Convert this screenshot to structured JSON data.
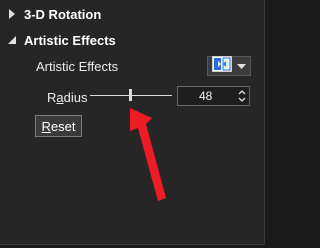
{
  "sections": {
    "rotation": {
      "title": "3-D Rotation",
      "expanded": false
    },
    "artistic": {
      "title": "Artistic Effects",
      "expanded": true
    }
  },
  "artistic_effects": {
    "label": "Artistic Effects",
    "radius": {
      "label_pre": "R",
      "label_underlined": "a",
      "label_post": "dius",
      "value": "48",
      "slider_fraction": 0.48
    },
    "reset": {
      "label_underlined": "R",
      "label_rest": "eset"
    }
  },
  "colors": {
    "pane_bg": "#262626",
    "accent_red": "#ee1c24",
    "effect_icon_blue": "#2a6fd6"
  },
  "icons": {
    "collapsed": "triangle-right-icon",
    "expanded": "triangle-down-icon",
    "effects": "artistic-effects-icon",
    "dropdown": "chevron-down-icon"
  }
}
